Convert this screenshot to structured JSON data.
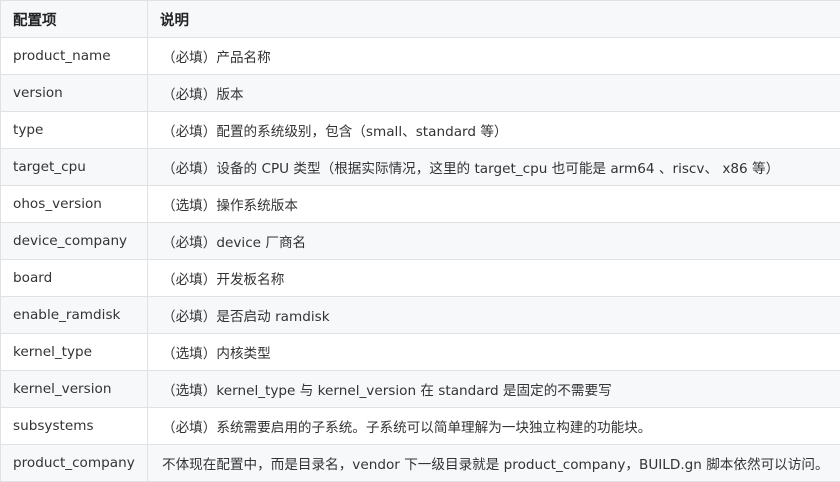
{
  "table": {
    "headers": [
      "配置项",
      "说明"
    ],
    "rows": [
      {
        "key": "product_name",
        "desc": "（必填）产品名称"
      },
      {
        "key": "version",
        "desc": "（必填）版本"
      },
      {
        "key": "type",
        "desc": "（必填）配置的系统级别，包含（small、standard 等）"
      },
      {
        "key": "target_cpu",
        "desc": "（必填）设备的 CPU 类型（根据实际情况，这里的 target_cpu 也可能是 arm64 、riscv、 x86 等）"
      },
      {
        "key": "ohos_version",
        "desc": "（选填）操作系统版本"
      },
      {
        "key": "device_company",
        "desc": "（必填）device 厂商名"
      },
      {
        "key": "board",
        "desc": "（必填）开发板名称"
      },
      {
        "key": "enable_ramdisk",
        "desc": "（必填）是否启动 ramdisk"
      },
      {
        "key": "kernel_type",
        "desc": "（选填）内核类型"
      },
      {
        "key": "kernel_version",
        "desc": "（选填）kernel_type 与 kernel_version 在 standard 是固定的不需要写"
      },
      {
        "key": "subsystems",
        "desc": "（必填）系统需要启用的子系统。子系统可以简单理解为一块独立构建的功能块。"
      },
      {
        "key": "product_company",
        "desc": "不体现在配置中，而是目录名，vendor 下一级目录就是 product_company，BUILD.gn 脚本依然可以访问。"
      }
    ]
  }
}
